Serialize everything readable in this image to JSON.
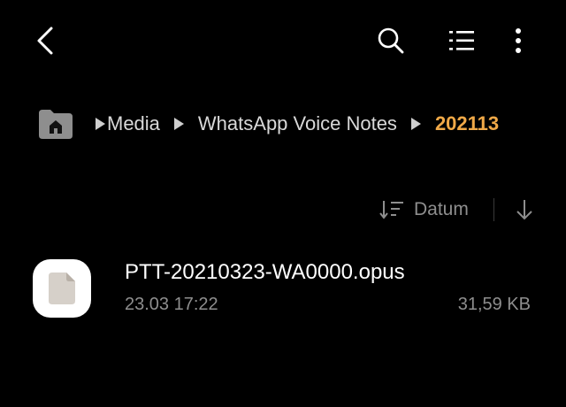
{
  "toolbar": {
    "back_icon": "back-arrow-icon",
    "search_icon": "search-icon",
    "list_view_icon": "list-view-icon",
    "more_icon": "more-vertical-icon"
  },
  "breadcrumb": {
    "home_icon": "home-folder-icon",
    "items": [
      {
        "label": "Media"
      },
      {
        "label": "WhatsApp Voice Notes"
      },
      {
        "label": "202113"
      }
    ],
    "current_color": "#f0a948"
  },
  "sort": {
    "field_label": "Datum",
    "sort_icon": "sort-icon",
    "order_icon": "arrow-down-icon"
  },
  "files": [
    {
      "name": "PTT-20210323-WA0000.opus",
      "date": "23.03 17:22",
      "size": "31,59 KB",
      "icon": "document-icon"
    }
  ],
  "colors": {
    "background": "#000000",
    "text_primary": "#ffffff",
    "text_secondary": "#8e8e8e",
    "accent": "#f0a948"
  }
}
